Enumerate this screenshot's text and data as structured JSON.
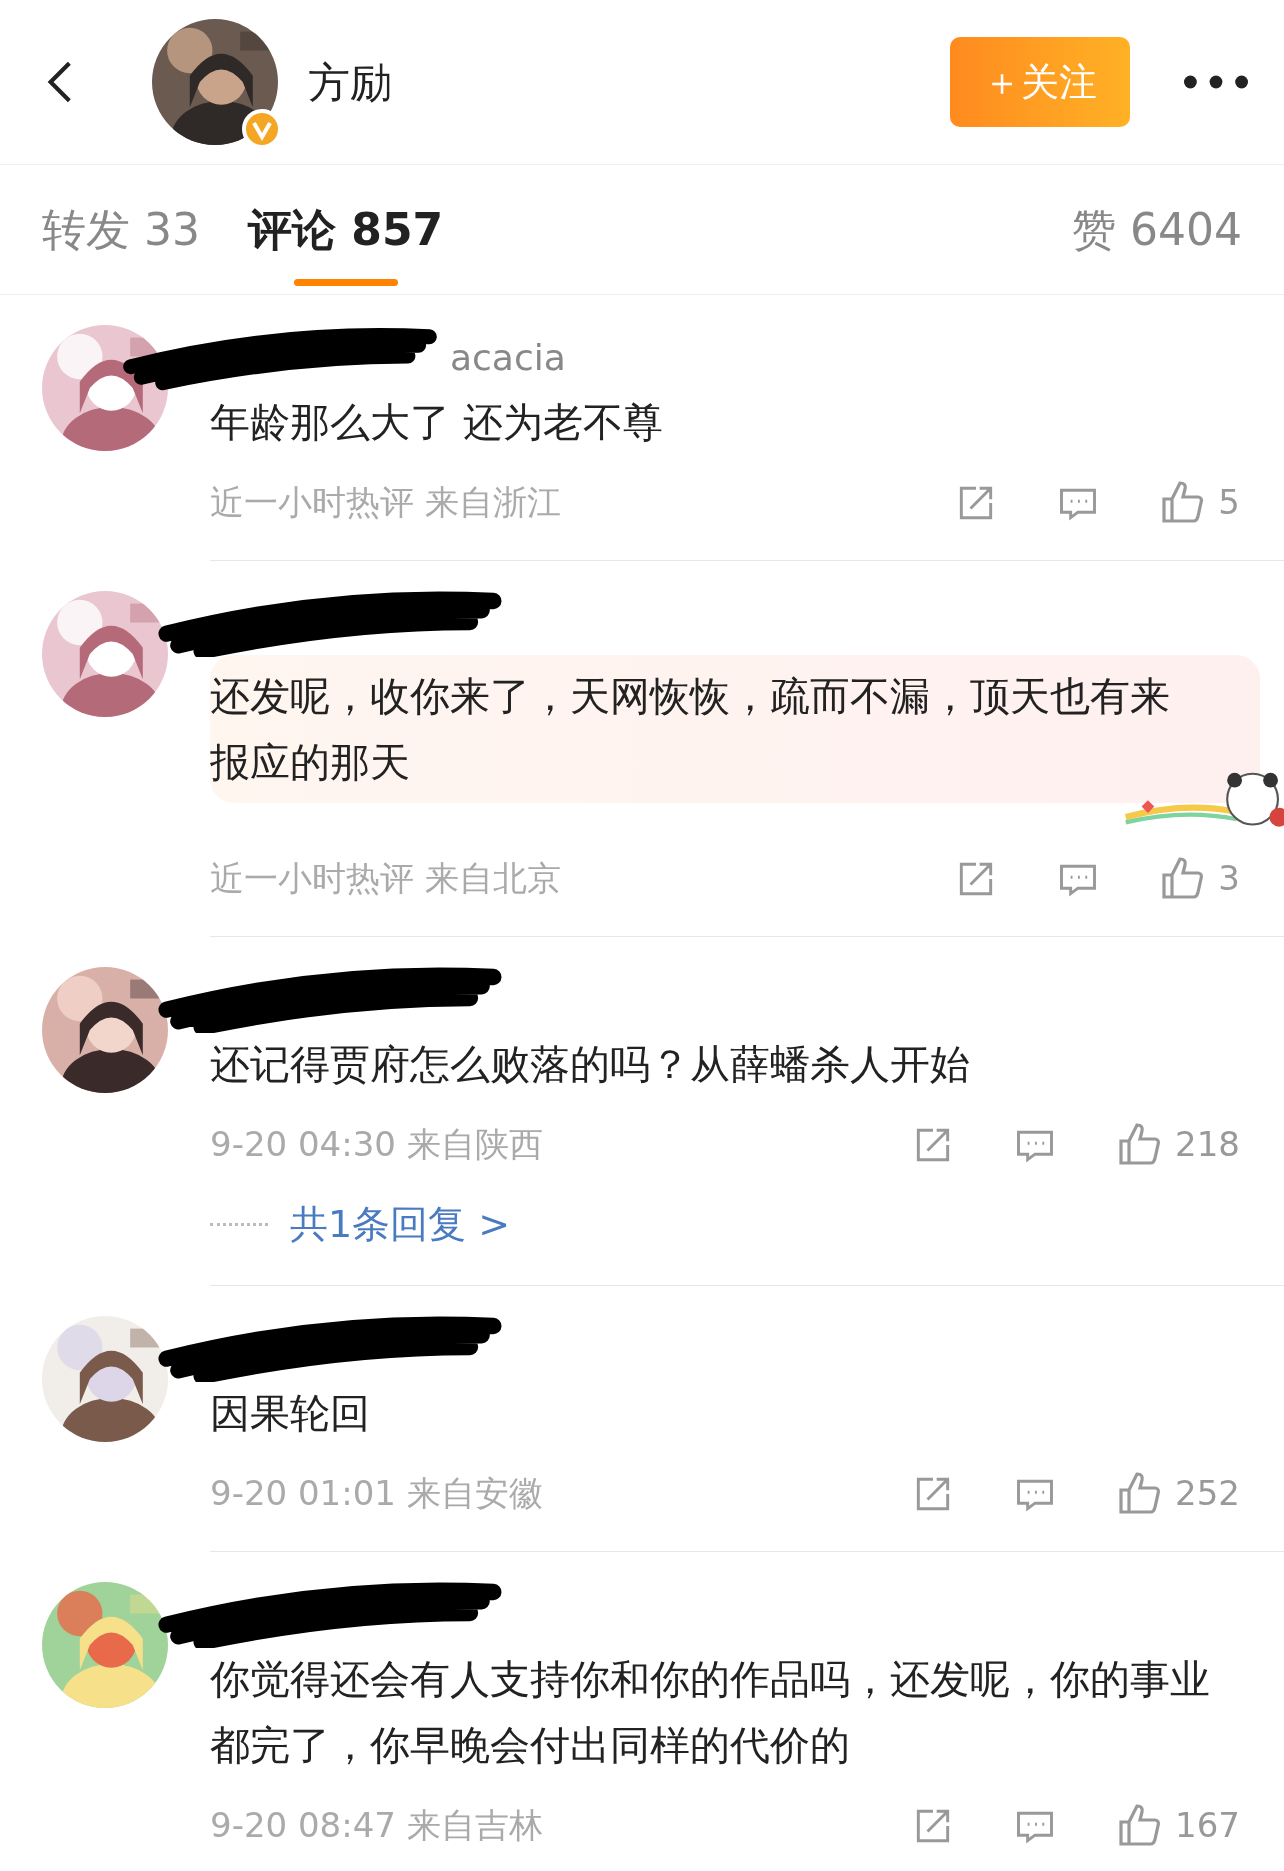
{
  "header": {
    "name": "方励",
    "verified": true,
    "follow_button": "＋关注"
  },
  "tabs": [
    {
      "label": "转发 33",
      "selected": false
    },
    {
      "label": "评论 857",
      "selected": true
    }
  ],
  "likes_tab": "赞 6404",
  "comments": [
    {
      "name": "acacia",
      "text": "年龄那么大了 还为老不尊",
      "meta": "近一小时热评  来自浙江",
      "likes": "5",
      "bubble": false
    },
    {
      "text": "还发呢，收你来了，天网恢恢，疏而不漏，顶天也有来报应的那天",
      "meta": "近一小时热评  来自北京",
      "likes": "3",
      "bubble": true
    },
    {
      "text": "还记得贾府怎么败落的吗？从薛蟠杀人开始",
      "meta": "9-20 04:30  来自陕西",
      "likes": "218",
      "bubble": false,
      "replies": "共1条回复 >"
    },
    {
      "text": "因果轮回",
      "meta": "9-20 01:01  来自安徽",
      "likes": "252",
      "bubble": false
    },
    {
      "text": "你觉得还会有人支持你和你的作品吗，还发呢，你的事业都完了，你早晚会付出同样的代价的",
      "meta": "9-20 08:47  来自吉林",
      "likes": "167",
      "bubble": false
    }
  ]
}
